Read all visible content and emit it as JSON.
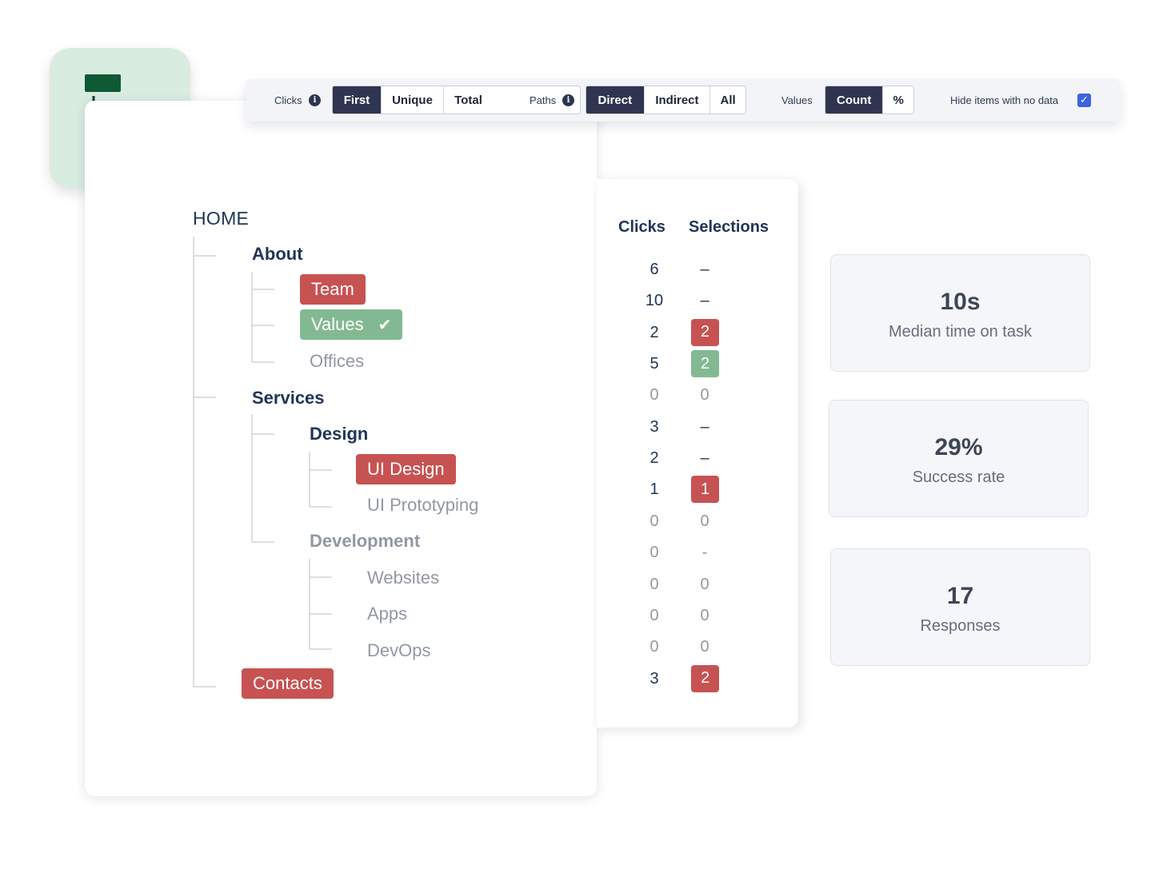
{
  "toolbar": {
    "clicks": {
      "label": "Clicks",
      "options": [
        "First",
        "Unique",
        "Total"
      ],
      "selected": "First"
    },
    "paths": {
      "label": "Paths",
      "options": [
        "Direct",
        "Indirect",
        "All"
      ],
      "selected": "Direct"
    },
    "values": {
      "label": "Values",
      "options": [
        "Count",
        "%"
      ],
      "selected": "Count"
    },
    "hide_empty": {
      "label": "Hide items with no data",
      "checked": true
    }
  },
  "tree": {
    "home": "HOME",
    "about": "About",
    "team": "Team",
    "values": "Values",
    "offices": "Offices",
    "services": "Services",
    "design": "Design",
    "ui_design": "UI Design",
    "ui_prototyping": "UI Prototyping",
    "development": "Development",
    "websites": "Websites",
    "apps": "Apps",
    "devops": "DevOps",
    "contacts": "Contacts"
  },
  "table": {
    "headers": {
      "clicks": "Clicks",
      "selections": "Selections"
    },
    "rows": [
      {
        "node": "About",
        "clicks": "6",
        "selections": "–",
        "status": "none"
      },
      {
        "node": "Team",
        "clicks": "10",
        "selections": "–",
        "status": "none"
      },
      {
        "node": "Values",
        "clicks": "2",
        "selections": "2",
        "status": "incorrect"
      },
      {
        "node": "Offices",
        "clicks": "5",
        "selections": "2",
        "status": "correct"
      },
      {
        "node": "Services",
        "clicks": "0",
        "selections": "0",
        "status": "empty"
      },
      {
        "node": "Design",
        "clicks": "3",
        "selections": "–",
        "status": "none"
      },
      {
        "node": "UI Design",
        "clicks": "2",
        "selections": "–",
        "status": "none"
      },
      {
        "node": "UI Prototyping",
        "clicks": "1",
        "selections": "1",
        "status": "incorrect"
      },
      {
        "node": "Development",
        "clicks": "0",
        "selections": "0",
        "status": "empty"
      },
      {
        "node": "Websites",
        "clicks": "0",
        "selections": "-",
        "status": "empty"
      },
      {
        "node": "Apps",
        "clicks": "0",
        "selections": "0",
        "status": "empty"
      },
      {
        "node": "DevOps",
        "clicks": "0",
        "selections": "0",
        "status": "empty"
      },
      {
        "node": "Contacts",
        "clicks": "0",
        "selections": "0",
        "status": "empty"
      },
      {
        "node": "HOME",
        "clicks": "3",
        "selections": "2",
        "status": "incorrect"
      }
    ]
  },
  "stats": [
    {
      "value": "10s",
      "label": "Median time on task"
    },
    {
      "value": "29%",
      "label": "Success rate"
    },
    {
      "value": "17",
      "label": "Responses"
    }
  ],
  "colors": {
    "navy": "#2f3550",
    "incorrect": "#c75252",
    "correct": "#83b992",
    "tile_bg": "#d9ece0",
    "logo_dark": "#0e5a35",
    "logo_mid": "#128a3c",
    "logo_light": "#83c294"
  },
  "icons": {
    "app": "tree-structure-icon",
    "info": "info-icon",
    "check": "checkmark-icon",
    "checkbox": "checkbox-checked-icon"
  }
}
